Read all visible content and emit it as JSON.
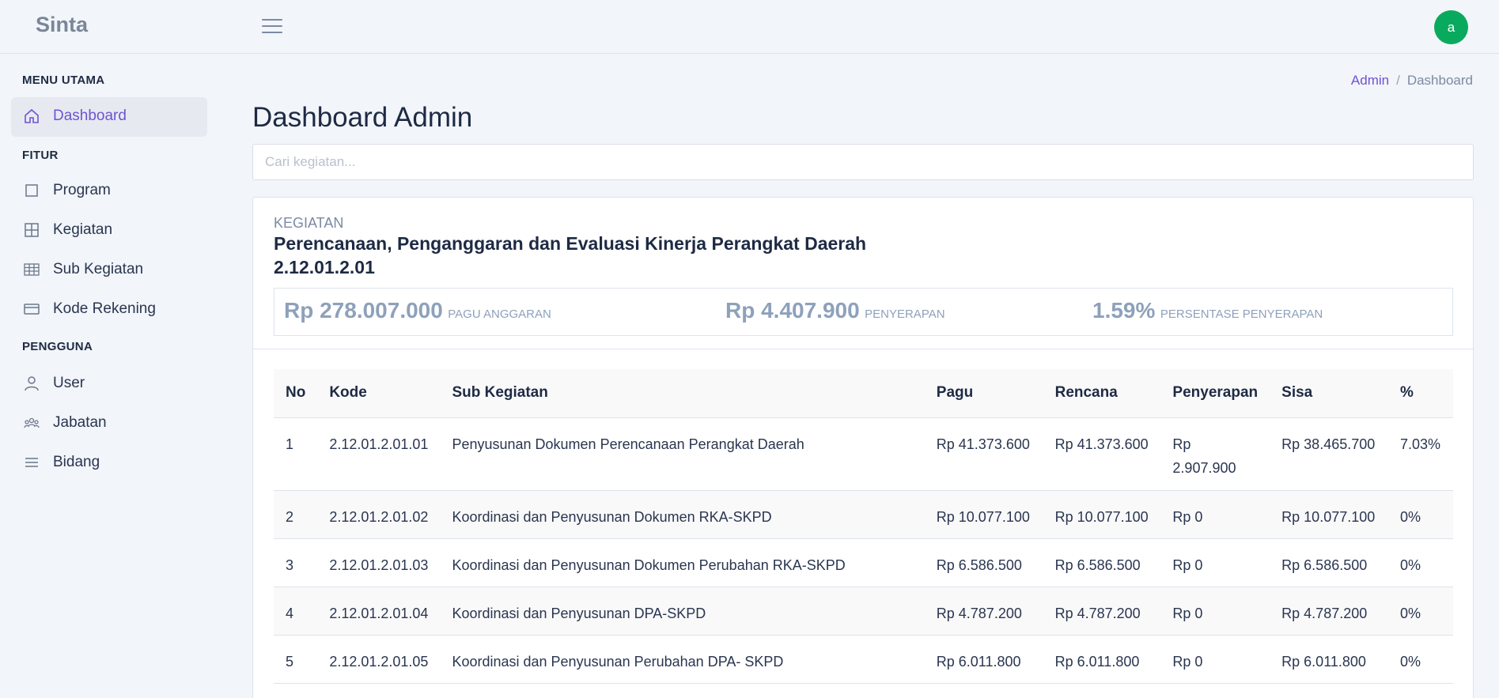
{
  "brand": "Sinta",
  "user": {
    "avatar_letter": "a"
  },
  "sidebar": {
    "sections": [
      {
        "header": "MENU UTAMA"
      },
      {
        "header": "FITUR"
      },
      {
        "header": "PENGGUNA"
      }
    ],
    "items": [
      {
        "label": "Dashboard",
        "icon": "home-icon"
      },
      {
        "label": "Program",
        "icon": "square-icon"
      },
      {
        "label": "Kegiatan",
        "icon": "grid-icon"
      },
      {
        "label": "Sub Kegiatan",
        "icon": "table-icon"
      },
      {
        "label": "Kode Rekening",
        "icon": "credit-card-icon"
      },
      {
        "label": "User",
        "icon": "user-icon"
      },
      {
        "label": "Jabatan",
        "icon": "users-icon"
      },
      {
        "label": "Bidang",
        "icon": "list-icon"
      }
    ]
  },
  "breadcrumb": {
    "parent": "Admin",
    "current": "Dashboard"
  },
  "page": {
    "title": "Dashboard Admin"
  },
  "search": {
    "placeholder": "Cari kegiatan..."
  },
  "kegiatan": {
    "label": "KEGIATAN",
    "name": "Perencanaan, Penganggaran dan Evaluasi Kinerja Perangkat Daerah",
    "code": "2.12.01.2.01",
    "stats": {
      "pagu": {
        "value": "Rp 278.007.000",
        "caption": "PAGU ANGGARAN"
      },
      "penyerapan": {
        "value": "Rp 4.407.900",
        "caption": "PENYERAPAN"
      },
      "persentase": {
        "value": "1.59%",
        "caption": "PERSENTASE PENYERAPAN"
      }
    }
  },
  "table": {
    "headers": [
      "No",
      "Kode",
      "Sub Kegiatan",
      "Pagu",
      "Rencana",
      "Penyerapan",
      "Sisa",
      "%"
    ],
    "rows": [
      [
        "1",
        "2.12.01.2.01.01",
        "Penyusunan Dokumen Perencanaan Perangkat Daerah",
        "Rp 41.373.600",
        "Rp 41.373.600",
        "Rp 2.907.900",
        "Rp 38.465.700",
        "7.03%"
      ],
      [
        "2",
        "2.12.01.2.01.02",
        "Koordinasi dan Penyusunan Dokumen RKA-SKPD",
        "Rp 10.077.100",
        "Rp 10.077.100",
        "Rp 0",
        "Rp 10.077.100",
        "0%"
      ],
      [
        "3",
        "2.12.01.2.01.03",
        "Koordinasi dan Penyusunan Dokumen Perubahan RKA-SKPD",
        "Rp 6.586.500",
        "Rp 6.586.500",
        "Rp 0",
        "Rp 6.586.500",
        "0%"
      ],
      [
        "4",
        "2.12.01.2.01.04",
        "Koordinasi dan Penyusunan DPA-SKPD",
        "Rp 4.787.200",
        "Rp 4.787.200",
        "Rp 0",
        "Rp 4.787.200",
        "0%"
      ],
      [
        "5",
        "2.12.01.2.01.05",
        "Koordinasi dan Penyusunan Perubahan DPA- SKPD",
        "Rp 6.011.800",
        "Rp 6.011.800",
        "Rp 0",
        "Rp 6.011.800",
        "0%"
      ]
    ]
  }
}
